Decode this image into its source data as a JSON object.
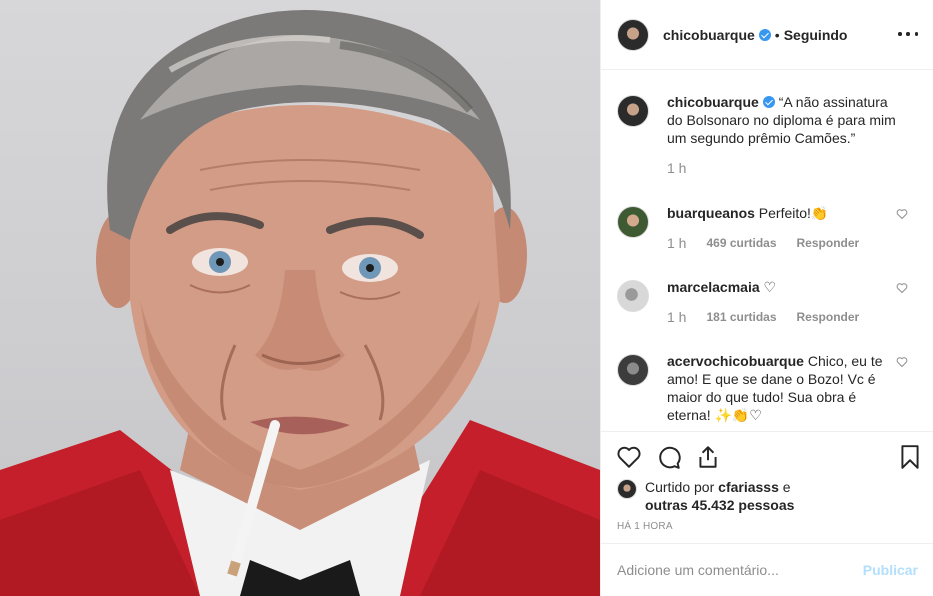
{
  "header": {
    "username": "chicobuarque",
    "separator": "•",
    "follow_label": "Seguindo"
  },
  "comments": [
    {
      "username": "chicobuarque",
      "text": "“A não assinatura do Bolsonaro no diploma é para mim um segundo prêmio Camões.”",
      "time": "1 h",
      "verified": true
    },
    {
      "username": "buarqueanos",
      "text": "Perfeito!👏",
      "time": "1 h",
      "likes": "469 curtidas",
      "reply": "Responder"
    },
    {
      "username": "marcelacmaia",
      "text": "♡",
      "time": "1 h",
      "likes": "181 curtidas",
      "reply": "Responder"
    },
    {
      "username": "acervochicobuarque",
      "text": "Chico, eu te amo! E que se dane o Bozo! Vc é maior do que tudo! Sua obra é eterna! ✨👏♡"
    }
  ],
  "likes": {
    "prefix": "Curtido por",
    "user": "cfariasss",
    "connector": "e",
    "others": "outras 45.432 pessoas"
  },
  "timestamp": "HÁ 1 HORA",
  "comment_box": {
    "placeholder": "Adicione um comentário...",
    "publish_label": "Publicar"
  },
  "icons": [
    "heart-icon",
    "comment-icon",
    "share-icon",
    "bookmark-icon",
    "more-icon",
    "verified-icon"
  ],
  "colors": {
    "accent": "#3897f0",
    "publish_disabled": "#b2dffc",
    "muted": "#8e8e8e",
    "jacket": "#c8202a"
  }
}
